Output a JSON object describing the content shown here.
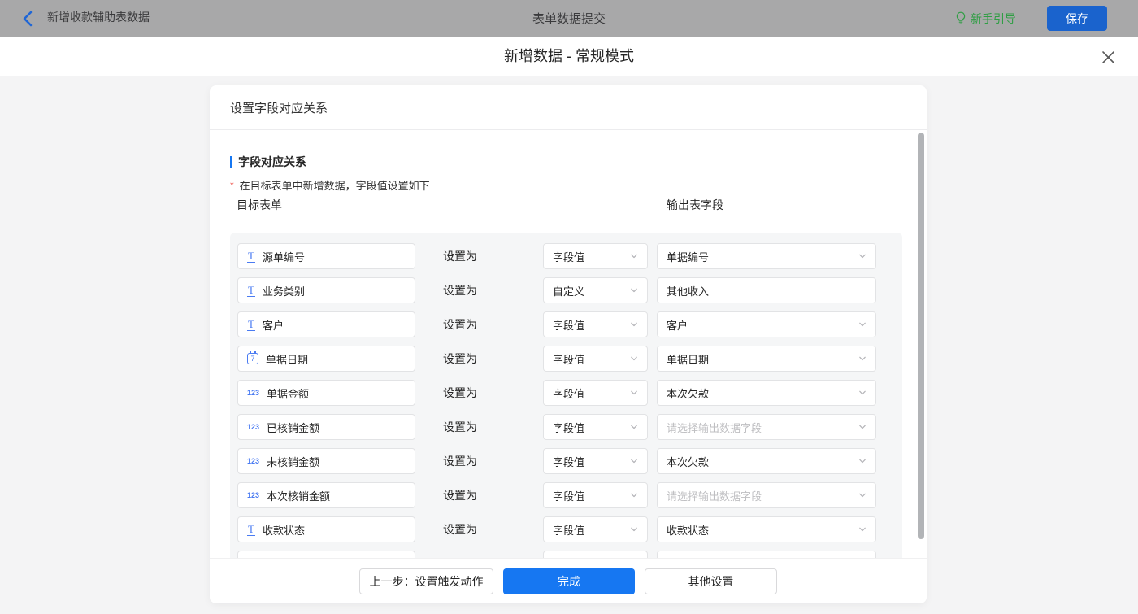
{
  "topbar": {
    "flow_name": "新增收款辅助表数据",
    "title": "表单数据提交",
    "guide_label": "新手引导",
    "save_label": "保存",
    "colors": {
      "bar_bg": "#a8a8a9",
      "save_blue": "#1a63cd",
      "guide_green": "#2f9e44",
      "back_blue": "#1f66d6"
    }
  },
  "modal": {
    "title": "新增数据 - 常规模式",
    "card_header": "设置字段对应关系",
    "section_title": "字段对应关系",
    "note_star": "*",
    "note": "在目标表单中新增数据，字段值设置如下",
    "col_left": "目标表单",
    "col_right": "输出表字段",
    "set_as_label": "设置为",
    "icons": {
      "text": "T",
      "number": "123",
      "date": "7"
    },
    "rows": [
      {
        "icon": "text",
        "field": "源单编号",
        "mode": "字段值",
        "output": "单据编号",
        "output_kind": "select"
      },
      {
        "icon": "text",
        "field": "业务类别",
        "mode": "自定义",
        "output": "其他收入",
        "output_kind": "input"
      },
      {
        "icon": "text",
        "field": "客户",
        "mode": "字段值",
        "output": "客户",
        "output_kind": "select"
      },
      {
        "icon": "date",
        "field": "单据日期",
        "mode": "字段值",
        "output": "单据日期",
        "output_kind": "select"
      },
      {
        "icon": "number",
        "field": "单据金额",
        "mode": "字段值",
        "output": "本次欠款",
        "output_kind": "select"
      },
      {
        "icon": "number",
        "field": "已核销金额",
        "mode": "字段值",
        "output": "请选择输出数据字段",
        "output_kind": "select",
        "is_placeholder": true
      },
      {
        "icon": "number",
        "field": "未核销金额",
        "mode": "字段值",
        "output": "本次欠款",
        "output_kind": "select"
      },
      {
        "icon": "number",
        "field": "本次核销金额",
        "mode": "字段值",
        "output": "请选择输出数据字段",
        "output_kind": "select",
        "is_placeholder": true
      },
      {
        "icon": "text",
        "field": "收款状态",
        "mode": "字段值",
        "output": "收款状态",
        "output_kind": "select"
      }
    ],
    "footer": {
      "prev_label": "上一步：设置触发动作",
      "done_label": "完成",
      "other_label": "其他设置"
    }
  }
}
